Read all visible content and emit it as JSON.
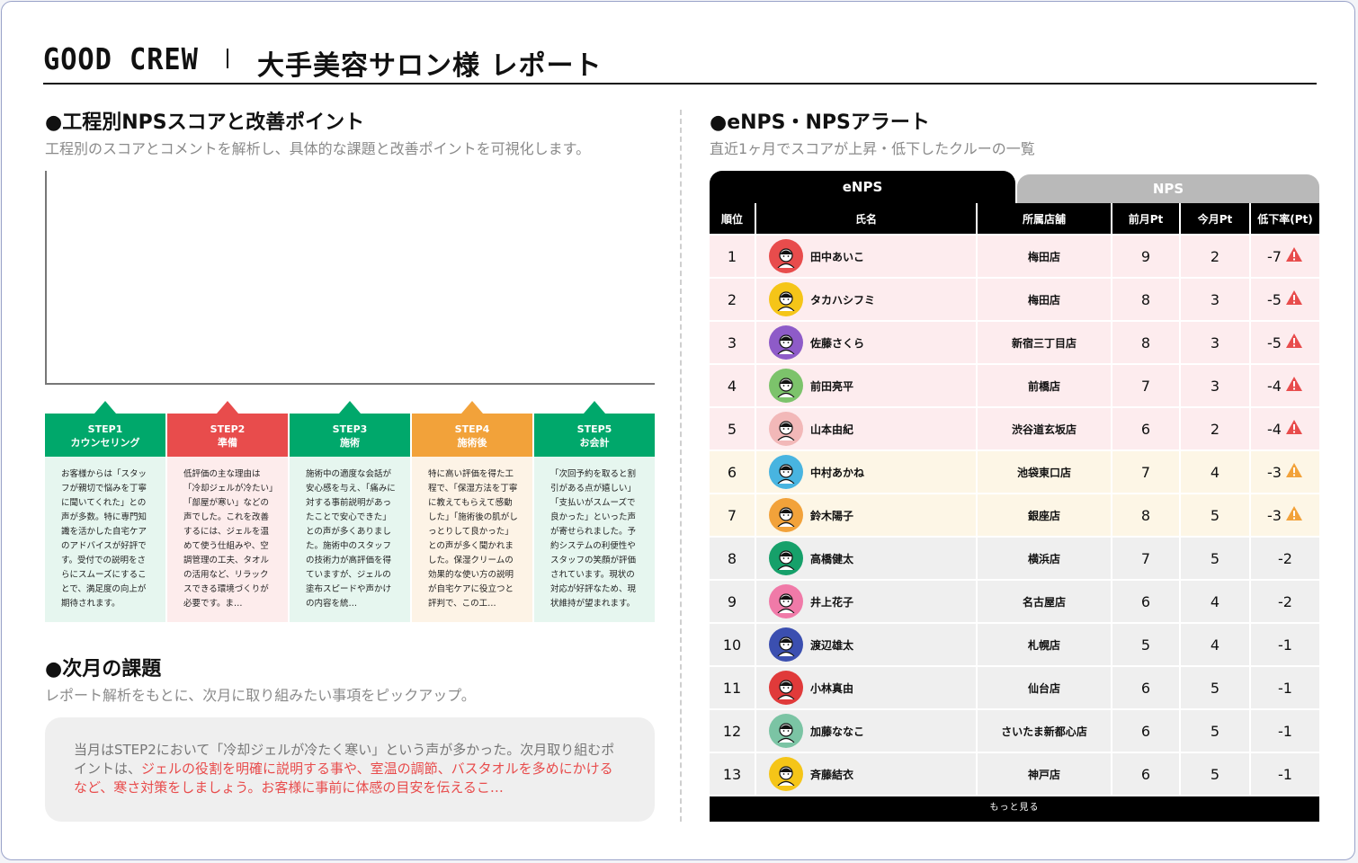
{
  "header": {
    "brand": "GOOD CREW",
    "title": "大手美容サロン様 レポート"
  },
  "nps_section": {
    "title": "●工程別NPSスコアと改善ポイント",
    "subtitle": "工程別のスコアとコメントを解析し、具体的な課題と改善ポイントを可視化します。"
  },
  "steps": [
    {
      "step": "STEP1",
      "label": "カウンセリング",
      "color": "#00a86b",
      "bg": "#e6f6ef",
      "comment": "お客様からは「スタッフが親切で悩みを丁寧に聞いてくれた」との声が多数。特に専門知識を活かした自宅ケアのアドバイスが好評です。受付での説明をさらにスムーズにすることで、満足度の向上が期待されます。"
    },
    {
      "step": "STEP2",
      "label": "準備",
      "color": "#e84c4c",
      "bg": "#fdecec",
      "comment": "低評価の主な理由は「冷却ジェルが冷たい」「部屋が寒い」などの声でした。これを改善するには、ジェルを温めて使う仕組みや、空調管理の工夫、タオルの活用など、リラックスできる環境づくりが必要です。ま…"
    },
    {
      "step": "STEP3",
      "label": "施術",
      "color": "#00a86b",
      "bg": "#e6f6ef",
      "comment": "施術中の適度な会話が安心感を与え、「痛みに対する事前説明があったことで安心できた」との声が多くありました。施術中のスタッフの技術力が高評価を得ていますが、ジェルの塗布スピードや声かけの内容を統…"
    },
    {
      "step": "STEP4",
      "label": "施術後",
      "color": "#f2a23a",
      "bg": "#fdf3e6",
      "comment": "特に高い評価を得た工程で、「保湿方法を丁寧に教えてもらえて感動した」「施術後の肌がしっとりして良かった」との声が多く聞かれました。保湿クリームの効果的な使い方の説明が自宅ケアに役立つと評判で、この工…"
    },
    {
      "step": "STEP5",
      "label": "お会計",
      "color": "#00a86b",
      "bg": "#e6f6ef",
      "comment": "「次回予約を取ると割引がある点が嬉しい」「支払いがスムーズで良かった」といった声が寄せられました。予約システムの利便性やスタッフの笑顔が評価されています。現状の対応が好評なため、現状維持が望まれます。"
    }
  ],
  "task_section": {
    "title": "●次月の課題",
    "subtitle": "レポート解析をもとに、次月に取り組みたい事項をピックアップ。",
    "text_normal": "当月はSTEP2において「冷却ジェルが冷たく寒い」という声が多かった。次月取り組むポイントは、",
    "text_highlight": "ジェルの役割を明確に説明する事や、室温の調節、バスタオルを多めにかけるなど、寒さ対策をしましょう。お客様に事前に体感の目安を伝えるこ…"
  },
  "alert_section": {
    "title": "●eNPS・NPSアラート",
    "subtitle": "直近1ヶ月でスコアが上昇・低下したクルーの一覧",
    "tab_enps": "eNPS",
    "tab_nps": "NPS",
    "headers": [
      "順位",
      "氏名",
      "所属店舗",
      "前月Pt",
      "今月Pt",
      "低下率(Pt)"
    ],
    "more_label": "もっと見る",
    "rows": [
      {
        "rank": "1",
        "name": "田中あいこ",
        "store": "梅田店",
        "prev": "9",
        "curr": "2",
        "drop": "-7",
        "level": "red",
        "avatar": "#e84c4c"
      },
      {
        "rank": "2",
        "name": "タカハシフミ",
        "store": "梅田店",
        "prev": "8",
        "curr": "3",
        "drop": "-5",
        "level": "red",
        "avatar": "#f5c518"
      },
      {
        "rank": "3",
        "name": "佐藤さくら",
        "store": "新宿三丁目店",
        "prev": "8",
        "curr": "3",
        "drop": "-5",
        "level": "red",
        "avatar": "#8e5bc8"
      },
      {
        "rank": "4",
        "name": "前田亮平",
        "store": "前橋店",
        "prev": "7",
        "curr": "3",
        "drop": "-4",
        "level": "red",
        "avatar": "#7cc36b"
      },
      {
        "rank": "5",
        "name": "山本由紀",
        "store": "渋谷道玄坂店",
        "prev": "6",
        "curr": "2",
        "drop": "-4",
        "level": "red",
        "avatar": "#f2b8b8"
      },
      {
        "rank": "6",
        "name": "中村あかね",
        "store": "池袋東口店",
        "prev": "7",
        "curr": "4",
        "drop": "-3",
        "level": "yellow",
        "avatar": "#48b4e0"
      },
      {
        "rank": "7",
        "name": "鈴木陽子",
        "store": "銀座店",
        "prev": "8",
        "curr": "5",
        "drop": "-3",
        "level": "yellow",
        "avatar": "#f2a23a"
      },
      {
        "rank": "8",
        "name": "高橋健太",
        "store": "横浜店",
        "prev": "7",
        "curr": "5",
        "drop": "-2",
        "level": "none",
        "avatar": "#16a06a"
      },
      {
        "rank": "9",
        "name": "井上花子",
        "store": "名古屋店",
        "prev": "6",
        "curr": "4",
        "drop": "-2",
        "level": "none",
        "avatar": "#f07aa8"
      },
      {
        "rank": "10",
        "name": "渡辺雄太",
        "store": "札幌店",
        "prev": "5",
        "curr": "4",
        "drop": "-1",
        "level": "none",
        "avatar": "#3b4fb0"
      },
      {
        "rank": "11",
        "name": "小林真由",
        "store": "仙台店",
        "prev": "6",
        "curr": "5",
        "drop": "-1",
        "level": "none",
        "avatar": "#e03a3a"
      },
      {
        "rank": "12",
        "name": "加藤ななこ",
        "store": "さいたま新都心店",
        "prev": "6",
        "curr": "5",
        "drop": "-1",
        "level": "none",
        "avatar": "#7bc4a4"
      },
      {
        "rank": "13",
        "name": "斉藤結衣",
        "store": "神戸店",
        "prev": "6",
        "curr": "5",
        "drop": "-1",
        "level": "none",
        "avatar": "#f5c518"
      }
    ]
  },
  "colors": {
    "row_red": "#fdecee",
    "row_yellow": "#fdf6e6",
    "row_none": "#efefef",
    "warn_red": "#e84c4c",
    "warn_yellow": "#f2a23a"
  }
}
